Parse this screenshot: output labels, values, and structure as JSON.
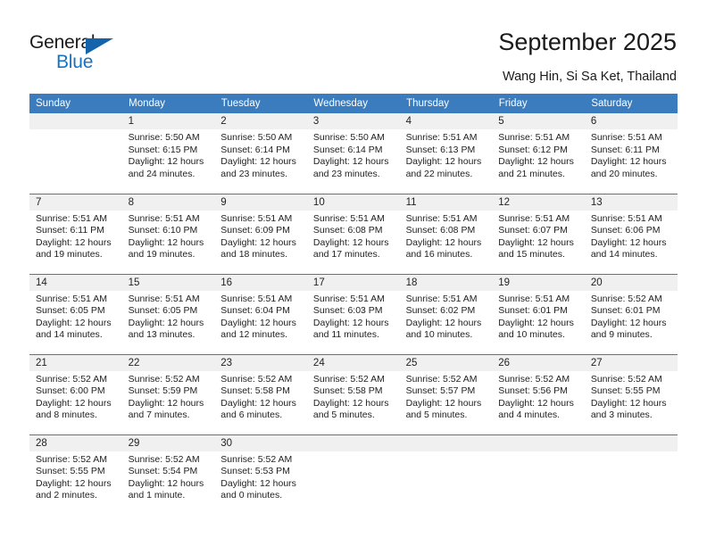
{
  "brand": {
    "name_part1": "General",
    "name_part2": "Blue",
    "accent_color": "#1672c4",
    "triangle_color": "#1464ac"
  },
  "header": {
    "title": "September 2025",
    "subtitle": "Wang Hin, Si Sa Ket, Thailand",
    "header_bg": "#3b7cbf",
    "daynum_bg": "#f0f0f0"
  },
  "weekdays": [
    "Sunday",
    "Monday",
    "Tuesday",
    "Wednesday",
    "Thursday",
    "Friday",
    "Saturday"
  ],
  "weeks": [
    [
      {
        "day": "",
        "sunrise": "",
        "sunset": "",
        "daylight1": "",
        "daylight2": "",
        "empty": true
      },
      {
        "day": "1",
        "sunrise": "Sunrise: 5:50 AM",
        "sunset": "Sunset: 6:15 PM",
        "daylight1": "Daylight: 12 hours",
        "daylight2": "and 24 minutes."
      },
      {
        "day": "2",
        "sunrise": "Sunrise: 5:50 AM",
        "sunset": "Sunset: 6:14 PM",
        "daylight1": "Daylight: 12 hours",
        "daylight2": "and 23 minutes."
      },
      {
        "day": "3",
        "sunrise": "Sunrise: 5:50 AM",
        "sunset": "Sunset: 6:14 PM",
        "daylight1": "Daylight: 12 hours",
        "daylight2": "and 23 minutes."
      },
      {
        "day": "4",
        "sunrise": "Sunrise: 5:51 AM",
        "sunset": "Sunset: 6:13 PM",
        "daylight1": "Daylight: 12 hours",
        "daylight2": "and 22 minutes."
      },
      {
        "day": "5",
        "sunrise": "Sunrise: 5:51 AM",
        "sunset": "Sunset: 6:12 PM",
        "daylight1": "Daylight: 12 hours",
        "daylight2": "and 21 minutes."
      },
      {
        "day": "6",
        "sunrise": "Sunrise: 5:51 AM",
        "sunset": "Sunset: 6:11 PM",
        "daylight1": "Daylight: 12 hours",
        "daylight2": "and 20 minutes."
      }
    ],
    [
      {
        "day": "7",
        "sunrise": "Sunrise: 5:51 AM",
        "sunset": "Sunset: 6:11 PM",
        "daylight1": "Daylight: 12 hours",
        "daylight2": "and 19 minutes."
      },
      {
        "day": "8",
        "sunrise": "Sunrise: 5:51 AM",
        "sunset": "Sunset: 6:10 PM",
        "daylight1": "Daylight: 12 hours",
        "daylight2": "and 19 minutes."
      },
      {
        "day": "9",
        "sunrise": "Sunrise: 5:51 AM",
        "sunset": "Sunset: 6:09 PM",
        "daylight1": "Daylight: 12 hours",
        "daylight2": "and 18 minutes."
      },
      {
        "day": "10",
        "sunrise": "Sunrise: 5:51 AM",
        "sunset": "Sunset: 6:08 PM",
        "daylight1": "Daylight: 12 hours",
        "daylight2": "and 17 minutes."
      },
      {
        "day": "11",
        "sunrise": "Sunrise: 5:51 AM",
        "sunset": "Sunset: 6:08 PM",
        "daylight1": "Daylight: 12 hours",
        "daylight2": "and 16 minutes."
      },
      {
        "day": "12",
        "sunrise": "Sunrise: 5:51 AM",
        "sunset": "Sunset: 6:07 PM",
        "daylight1": "Daylight: 12 hours",
        "daylight2": "and 15 minutes."
      },
      {
        "day": "13",
        "sunrise": "Sunrise: 5:51 AM",
        "sunset": "Sunset: 6:06 PM",
        "daylight1": "Daylight: 12 hours",
        "daylight2": "and 14 minutes."
      }
    ],
    [
      {
        "day": "14",
        "sunrise": "Sunrise: 5:51 AM",
        "sunset": "Sunset: 6:05 PM",
        "daylight1": "Daylight: 12 hours",
        "daylight2": "and 14 minutes."
      },
      {
        "day": "15",
        "sunrise": "Sunrise: 5:51 AM",
        "sunset": "Sunset: 6:05 PM",
        "daylight1": "Daylight: 12 hours",
        "daylight2": "and 13 minutes."
      },
      {
        "day": "16",
        "sunrise": "Sunrise: 5:51 AM",
        "sunset": "Sunset: 6:04 PM",
        "daylight1": "Daylight: 12 hours",
        "daylight2": "and 12 minutes."
      },
      {
        "day": "17",
        "sunrise": "Sunrise: 5:51 AM",
        "sunset": "Sunset: 6:03 PM",
        "daylight1": "Daylight: 12 hours",
        "daylight2": "and 11 minutes."
      },
      {
        "day": "18",
        "sunrise": "Sunrise: 5:51 AM",
        "sunset": "Sunset: 6:02 PM",
        "daylight1": "Daylight: 12 hours",
        "daylight2": "and 10 minutes."
      },
      {
        "day": "19",
        "sunrise": "Sunrise: 5:51 AM",
        "sunset": "Sunset: 6:01 PM",
        "daylight1": "Daylight: 12 hours",
        "daylight2": "and 10 minutes."
      },
      {
        "day": "20",
        "sunrise": "Sunrise: 5:52 AM",
        "sunset": "Sunset: 6:01 PM",
        "daylight1": "Daylight: 12 hours",
        "daylight2": "and 9 minutes."
      }
    ],
    [
      {
        "day": "21",
        "sunrise": "Sunrise: 5:52 AM",
        "sunset": "Sunset: 6:00 PM",
        "daylight1": "Daylight: 12 hours",
        "daylight2": "and 8 minutes."
      },
      {
        "day": "22",
        "sunrise": "Sunrise: 5:52 AM",
        "sunset": "Sunset: 5:59 PM",
        "daylight1": "Daylight: 12 hours",
        "daylight2": "and 7 minutes."
      },
      {
        "day": "23",
        "sunrise": "Sunrise: 5:52 AM",
        "sunset": "Sunset: 5:58 PM",
        "daylight1": "Daylight: 12 hours",
        "daylight2": "and 6 minutes."
      },
      {
        "day": "24",
        "sunrise": "Sunrise: 5:52 AM",
        "sunset": "Sunset: 5:58 PM",
        "daylight1": "Daylight: 12 hours",
        "daylight2": "and 5 minutes."
      },
      {
        "day": "25",
        "sunrise": "Sunrise: 5:52 AM",
        "sunset": "Sunset: 5:57 PM",
        "daylight1": "Daylight: 12 hours",
        "daylight2": "and 5 minutes."
      },
      {
        "day": "26",
        "sunrise": "Sunrise: 5:52 AM",
        "sunset": "Sunset: 5:56 PM",
        "daylight1": "Daylight: 12 hours",
        "daylight2": "and 4 minutes."
      },
      {
        "day": "27",
        "sunrise": "Sunrise: 5:52 AM",
        "sunset": "Sunset: 5:55 PM",
        "daylight1": "Daylight: 12 hours",
        "daylight2": "and 3 minutes."
      }
    ],
    [
      {
        "day": "28",
        "sunrise": "Sunrise: 5:52 AM",
        "sunset": "Sunset: 5:55 PM",
        "daylight1": "Daylight: 12 hours",
        "daylight2": "and 2 minutes."
      },
      {
        "day": "29",
        "sunrise": "Sunrise: 5:52 AM",
        "sunset": "Sunset: 5:54 PM",
        "daylight1": "Daylight: 12 hours",
        "daylight2": "and 1 minute."
      },
      {
        "day": "30",
        "sunrise": "Sunrise: 5:52 AM",
        "sunset": "Sunset: 5:53 PM",
        "daylight1": "Daylight: 12 hours",
        "daylight2": "and 0 minutes."
      },
      {
        "day": "",
        "sunrise": "",
        "sunset": "",
        "daylight1": "",
        "daylight2": "",
        "empty": true
      },
      {
        "day": "",
        "sunrise": "",
        "sunset": "",
        "daylight1": "",
        "daylight2": "",
        "empty": true
      },
      {
        "day": "",
        "sunrise": "",
        "sunset": "",
        "daylight1": "",
        "daylight2": "",
        "empty": true
      },
      {
        "day": "",
        "sunrise": "",
        "sunset": "",
        "daylight1": "",
        "daylight2": "",
        "empty": true
      }
    ]
  ]
}
